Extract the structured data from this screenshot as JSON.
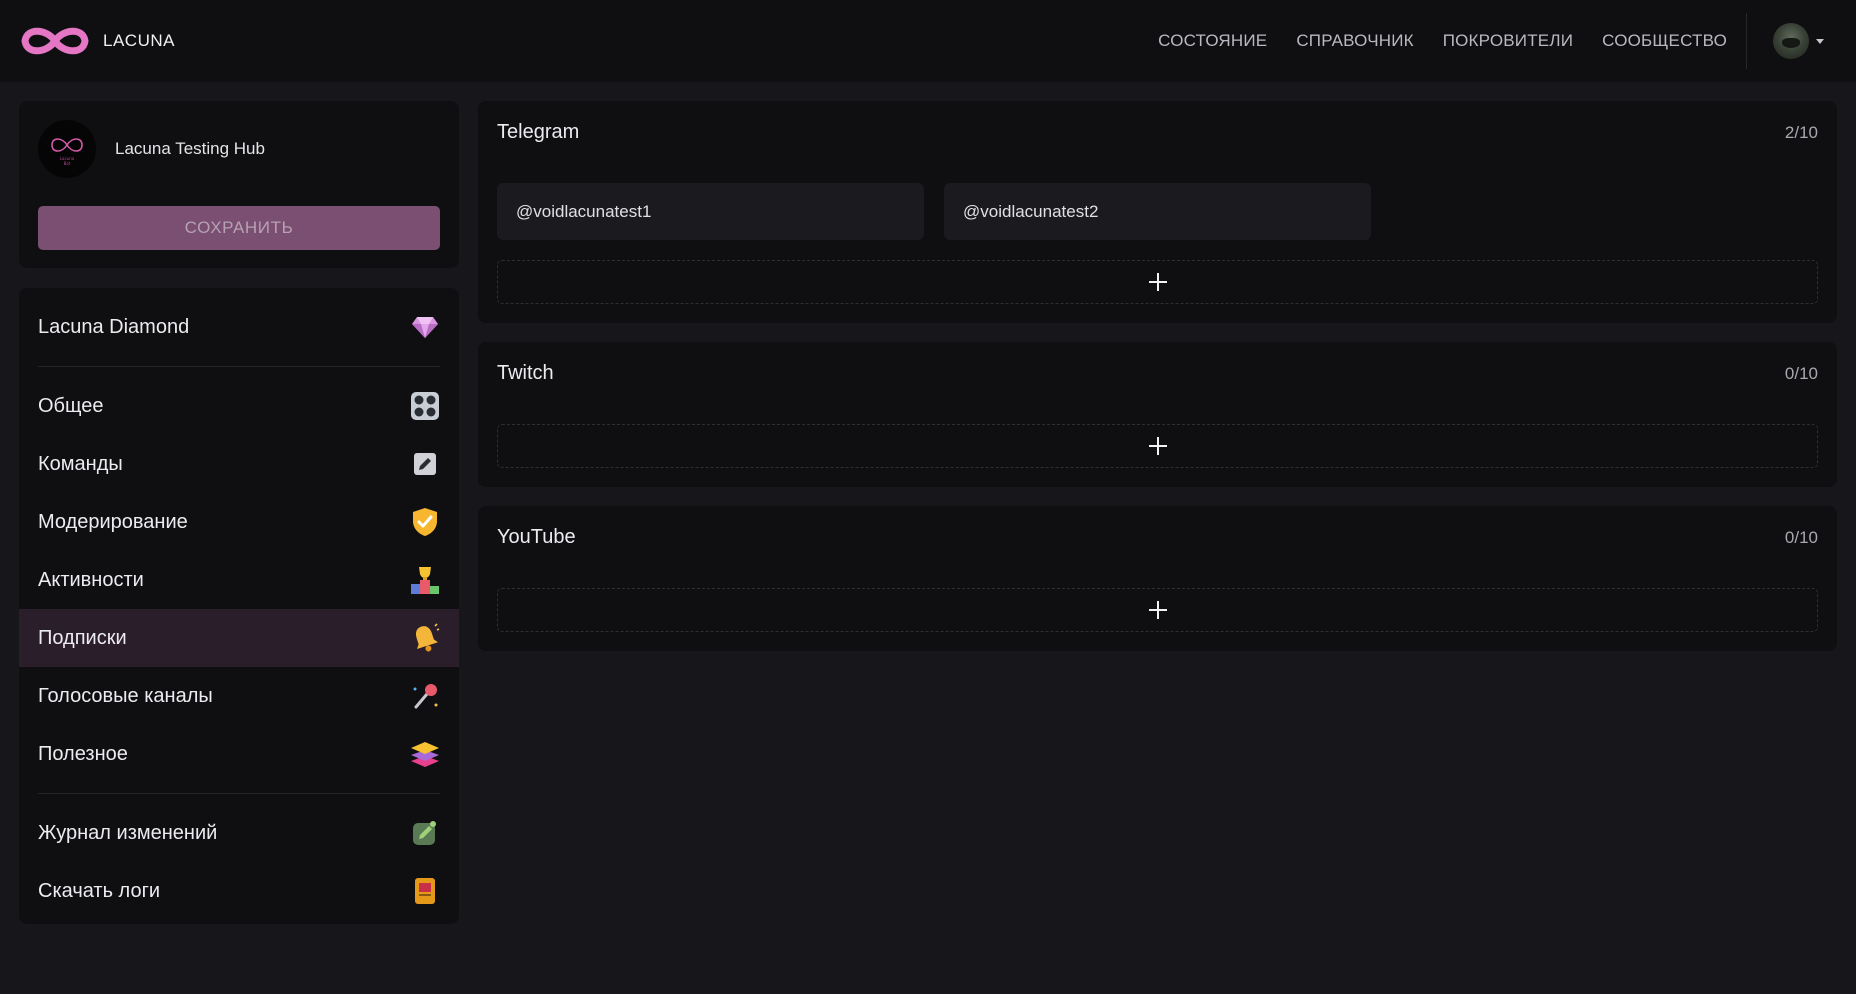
{
  "header": {
    "brand": "LACUNA",
    "nav": [
      "СОСТОЯНИЕ",
      "СПРАВОЧНИК",
      "ПОКРОВИТЕЛИ",
      "СООБЩЕСТВО"
    ]
  },
  "server": {
    "name": "Lacuna Testing Hub",
    "save_label": "СОХРАНИТЬ"
  },
  "menu": {
    "premium": {
      "label": "Lacuna Diamond",
      "icon": "diamond-icon"
    },
    "main": [
      {
        "label": "Общее",
        "icon": "dashboard-icon"
      },
      {
        "label": "Команды",
        "icon": "pencil-icon"
      },
      {
        "label": "Модерирование",
        "icon": "shield-icon"
      },
      {
        "label": "Активности",
        "icon": "trophy-icon"
      },
      {
        "label": "Подписки",
        "icon": "bell-icon",
        "active": true
      },
      {
        "label": "Голосовые каналы",
        "icon": "microphone-icon"
      },
      {
        "label": "Полезное",
        "icon": "layers-icon"
      }
    ],
    "footer": [
      {
        "label": "Журнал изменений",
        "icon": "edit-note-icon"
      },
      {
        "label": "Скачать логи",
        "icon": "download-log-icon"
      }
    ]
  },
  "sections": [
    {
      "title": "Telegram",
      "count": "2/10",
      "channels": [
        "@voidlacunatest1",
        "@voidlacunatest2"
      ]
    },
    {
      "title": "Twitch",
      "count": "0/10",
      "channels": []
    },
    {
      "title": "YouTube",
      "count": "0/10",
      "channels": []
    }
  ],
  "colors": {
    "accent": "#e476c4",
    "save_button": "#7a4f72",
    "active_item": "#2a1e2b",
    "background": "#16161b",
    "panel": "#0f0f12"
  }
}
